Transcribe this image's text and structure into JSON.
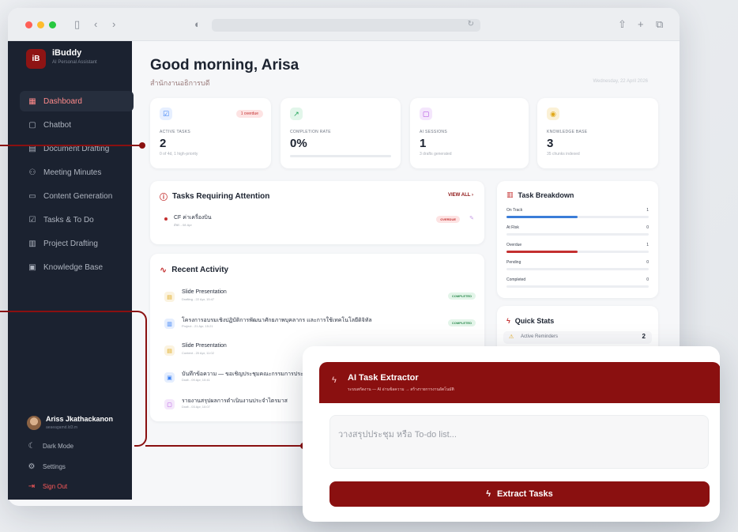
{
  "brand": {
    "logo": "iB",
    "name": "iBuddy",
    "subtitle": "AI Personal Assistant",
    "accent": "#8a1010"
  },
  "sidebar": {
    "items": [
      {
        "label": "Dashboard",
        "icon": "grid-icon",
        "glyph": "▦",
        "active": true
      },
      {
        "label": "Chatbot",
        "icon": "chat-icon",
        "glyph": "▢"
      },
      {
        "label": "Document Drafting",
        "icon": "document-icon",
        "glyph": "▤"
      },
      {
        "label": "Meeting Minutes",
        "icon": "people-icon",
        "glyph": "⚇"
      },
      {
        "label": "Content Generation",
        "icon": "monitor-icon",
        "glyph": "▭"
      },
      {
        "label": "Tasks & To Do",
        "icon": "checkbox-icon",
        "glyph": "☑"
      },
      {
        "label": "Project Drafting",
        "icon": "bar-chart-icon",
        "glyph": "▥"
      },
      {
        "label": "Knowledge Base",
        "icon": "book-icon",
        "glyph": "▣"
      }
    ],
    "user": {
      "name": "Ariss Jkathackanon",
      "email": "aeaeagamd.ld3.m"
    },
    "links": [
      {
        "label": "Dark Mode",
        "glyph": "☾"
      },
      {
        "label": "Settings",
        "glyph": "⚙"
      },
      {
        "label": "Sign Out",
        "glyph": "⇥"
      }
    ]
  },
  "header": {
    "greeting": "Good morning, Arisa",
    "org": "สำนักงานอธิการบดี",
    "date": "Wednesday, 22 April 2026"
  },
  "stats": [
    {
      "label": "ACTIVE TASKS",
      "value": "2",
      "sub": "0 of 4d, 1 high-priority",
      "badge": "1 overdue",
      "icon": "checkbox-icon",
      "glyph": "☑",
      "color": "#3b82f6"
    },
    {
      "label": "COMPLETION RATE",
      "value": "0%",
      "sub": "",
      "icon": "trend-up-icon",
      "glyph": "↗",
      "color": "#22a55a",
      "progress": 0
    },
    {
      "label": "AI SESSIONS",
      "value": "1",
      "sub": "3 drafts generated",
      "icon": "chat-icon",
      "glyph": "▢",
      "color": "#b04be0"
    },
    {
      "label": "KNOWLEDGE BASE",
      "value": "3",
      "sub": "35 chunks indexed",
      "icon": "database-icon",
      "glyph": "◉",
      "color": "#e0a81a"
    }
  ],
  "attention": {
    "title": "Tasks Requiring Attention",
    "view_all": "VIEW ALL ›",
    "items": [
      {
        "title": "CF ค่าเครื่องบิน",
        "meta": "อัพก - 08 Apr",
        "badge": "OVERDUE"
      }
    ]
  },
  "breakdown": {
    "title": "Task Breakdown",
    "rows": [
      {
        "label": "On Track",
        "value": "1",
        "fraction": 0.5,
        "color": "#3b7dd8"
      },
      {
        "label": "At Risk",
        "value": "0",
        "fraction": 0,
        "color": "#e0a81a"
      },
      {
        "label": "Overdue",
        "value": "1",
        "fraction": 0.5,
        "color": "#c43030"
      },
      {
        "label": "Pending",
        "value": "0",
        "fraction": 0,
        "color": "#9aa0a8"
      },
      {
        "label": "Completed",
        "value": "0",
        "fraction": 0,
        "color": "#22a55a"
      }
    ]
  },
  "activity": {
    "title": "Recent Activity",
    "items": [
      {
        "title": "Slide Presentation",
        "meta": "Drafting - 22 Apr, 15:47",
        "status": "COMPLETED",
        "glyph": "▤",
        "color": "#e0a81a"
      },
      {
        "title": "โครงการอบรมเชิงปฏิบัติการพัฒนาศักยภาพบุคลากร และการใช้เทคโนโลยีดิจิทัล",
        "meta": "Project - 21 Apr, 15:21",
        "status": "COMPLETED",
        "glyph": "▥",
        "color": "#3b82f6"
      },
      {
        "title": "Slide Presentation",
        "meta": "Content - 20 Apr, 11:02",
        "status": "COMPLETED",
        "glyph": "▤",
        "color": "#e0a81a"
      },
      {
        "title": "บันทึกข้อความ — ขอเชิญประชุมคณะกรรมการประจำหน่วยงาน",
        "meta": "Draft - 09 Apr, 10:41",
        "status": "",
        "glyph": "▣",
        "color": "#3b82f6"
      },
      {
        "title": "รายงานสรุปผลการดำเนินงานประจำไตรมาส",
        "meta": "Draft - 03 Apr, 10:07",
        "status": "",
        "glyph": "▢",
        "color": "#b04be0"
      }
    ]
  },
  "quick_stats": {
    "title": "Quick Stats",
    "rows": [
      {
        "label": "Active Reminders",
        "value": "2"
      }
    ]
  },
  "extractor": {
    "title": "AI Task Extractor",
    "subtitle": "ระบบสกัดงาน — AI อ่านข้อความ → สร้างรายการงานอัตโนมัติ",
    "placeholder": "วางสรุปประชุม หรือ To-do list...",
    "button": "Extract Tasks"
  }
}
